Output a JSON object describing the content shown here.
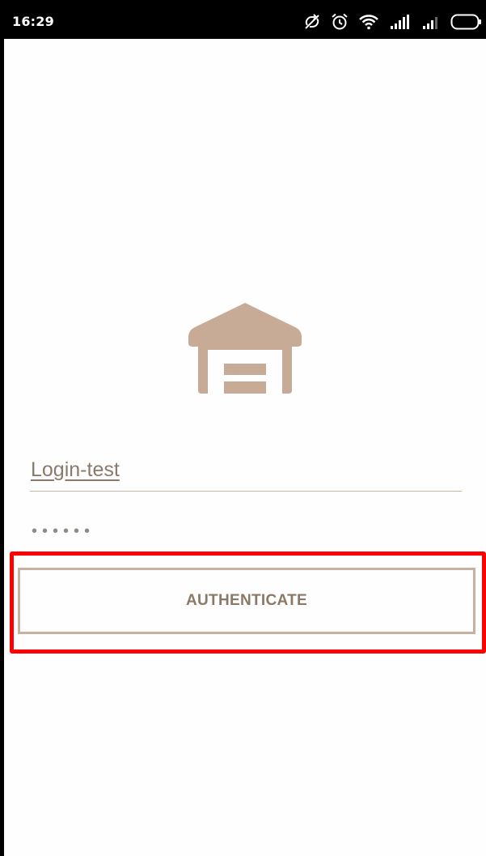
{
  "status_bar": {
    "time": "16:29",
    "icons": [
      "no-sync-icon",
      "alarm-icon",
      "wifi-icon",
      "signal-icon",
      "signal-icon",
      "battery-icon"
    ]
  },
  "app": {
    "logo_icon": "warehouse-icon",
    "accent_color": "#c8ab97",
    "button_text_color": "#8b7866"
  },
  "login_form": {
    "username_value": "Login-test",
    "password_mask": "••••••",
    "submit_label": "AUTHENTICATE"
  },
  "annotation": {
    "highlight_color": "#ff0000"
  }
}
